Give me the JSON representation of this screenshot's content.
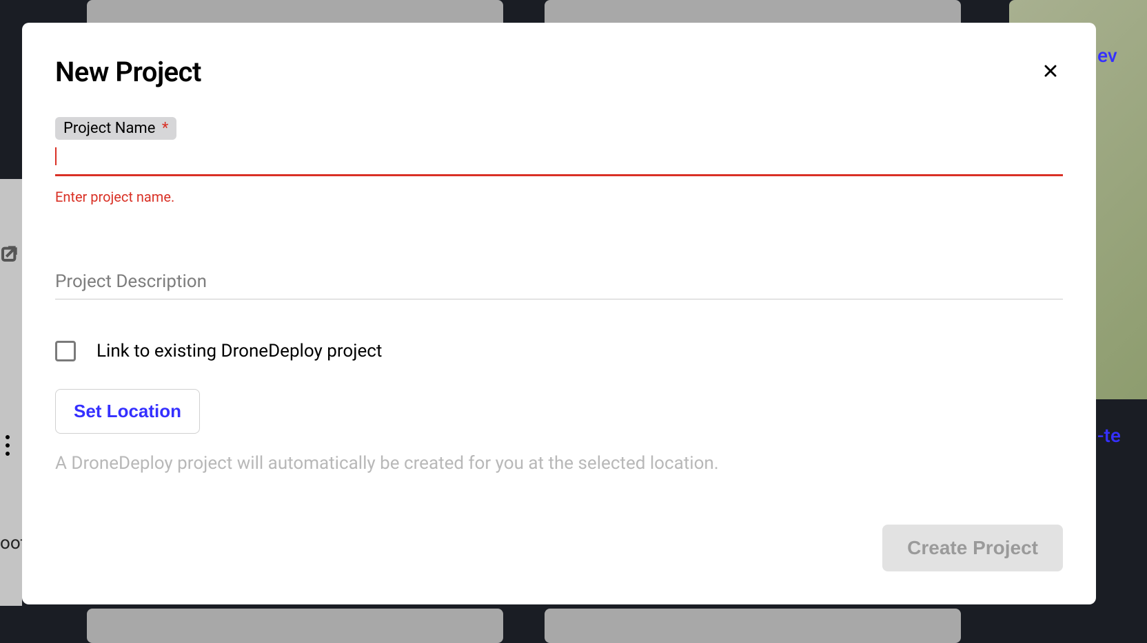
{
  "modal": {
    "title": "New Project",
    "project_name": {
      "label": "Project Name",
      "required_mark": "*",
      "value": "",
      "error": "Enter project name."
    },
    "project_description": {
      "placeholder": "Project Description",
      "value": ""
    },
    "link_checkbox": {
      "label": "Link to existing DroneDeploy project",
      "checked": false
    },
    "set_location_label": "Set Location",
    "helper_text": "A DroneDeploy project will automatically be created for you at the selected location.",
    "create_button_label": "Create Project"
  },
  "background": {
    "link_text_right_top": "ev",
    "link_text_right_mid": "-te",
    "text_bottom_left": "oot"
  }
}
